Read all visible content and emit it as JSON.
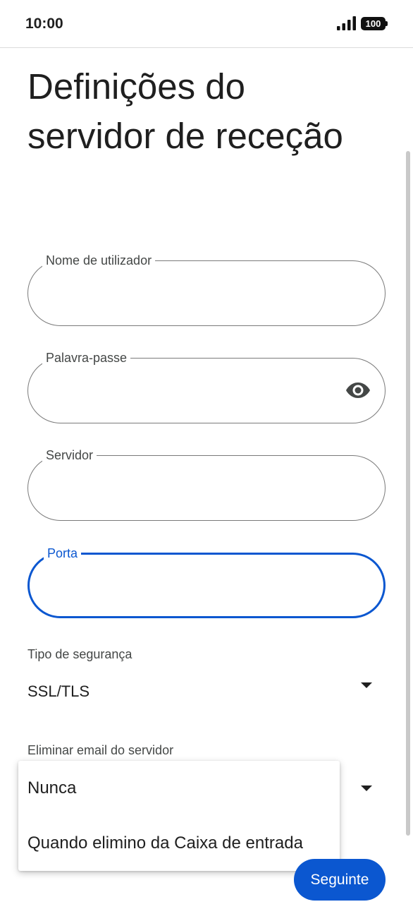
{
  "status_bar": {
    "time": "10:00",
    "battery": "100",
    "icons": [
      "signal-icon",
      "battery-icon"
    ]
  },
  "page": {
    "title": "Definições do servidor de receção"
  },
  "form": {
    "username": {
      "label": "Nome de utilizador",
      "value": ""
    },
    "password": {
      "label": "Palavra-passe",
      "value": "",
      "toggle_icon": "eye-icon"
    },
    "server": {
      "label": "Servidor",
      "value": ""
    },
    "port": {
      "label": "Porta",
      "value": "",
      "focused": true
    },
    "security_type": {
      "label": "Tipo de segurança",
      "value": "SSL/TLS"
    },
    "delete_email": {
      "label": "Eliminar email do servidor",
      "value": "Nunca"
    }
  },
  "dropdown_menu": {
    "items": [
      "Nunca",
      "Quando elimino da Caixa de entrada"
    ]
  },
  "actions": {
    "next_label": "Seguinte"
  },
  "colors": {
    "accent": "#0b57d0",
    "outline": "#7a7a7a",
    "text": "#1f1f1f",
    "label": "#444746"
  }
}
